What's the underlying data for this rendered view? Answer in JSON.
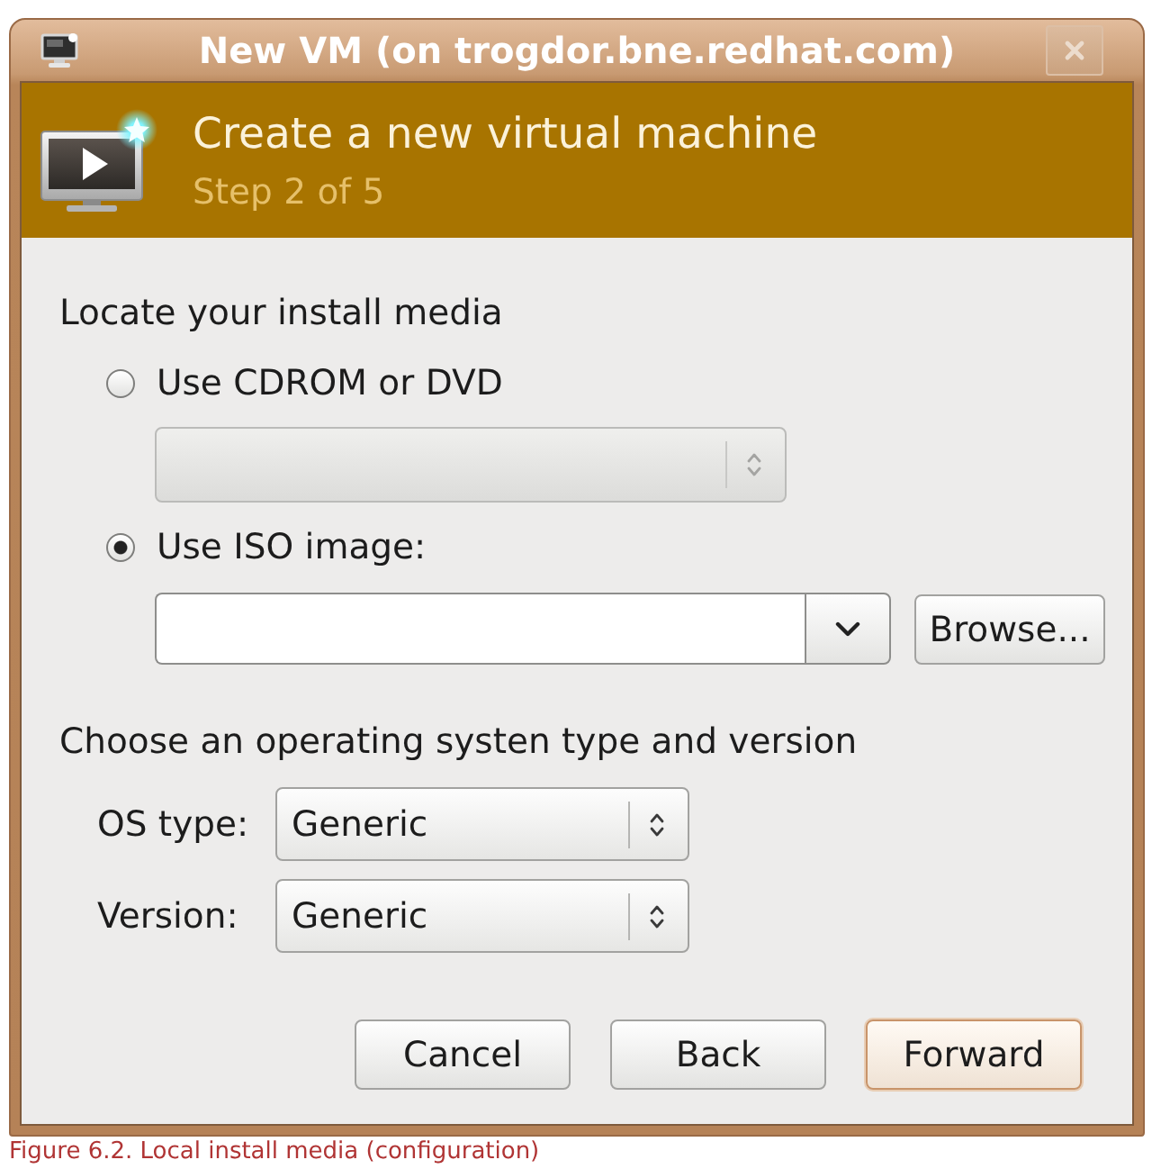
{
  "window": {
    "title": "New VM (on trogdor.bne.redhat.com)"
  },
  "header": {
    "title": "Create a new virtual machine",
    "step": "Step 2 of 5"
  },
  "install_media": {
    "heading": "Locate your install media",
    "options": [
      {
        "kind": "device",
        "label": "Use CDROM or DVD",
        "selected": false,
        "field": {
          "disabled": true
        }
      },
      {
        "kind": "iso",
        "label": "Use ISO image:",
        "selected": true,
        "field": {
          "disabled": false
        },
        "browse_button": {
          "label": "Browse..."
        }
      }
    ]
  },
  "os": {
    "heading": "Choose an operating systen type and version",
    "fields": [
      {
        "label": "OS type:",
        "value": "Generic"
      },
      {
        "label": "Version:",
        "value": "Generic"
      }
    ]
  },
  "buttons": [
    {
      "label": "Cancel",
      "focused": false
    },
    {
      "label": "Back",
      "focused": false
    },
    {
      "label": "Forward",
      "focused": true
    }
  ],
  "caption": "Figure 6.2. Local install media (configuration)"
}
